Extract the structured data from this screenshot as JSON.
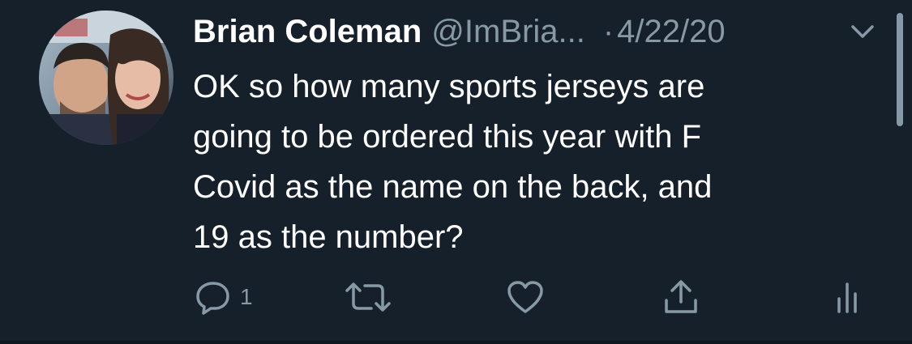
{
  "tweet": {
    "author": {
      "display_name": "Brian Coleman",
      "handle": "@ImBria...",
      "avatar": "profile-photo"
    },
    "separator": "·",
    "date": "4/22/20",
    "text": "OK so how many sports jerseys are\ngoing to be ordered this year with F\nCovid as the name on the back, and\n19 as the number?",
    "actions": {
      "reply_count": "1"
    }
  },
  "icons": {
    "menu": "chevron-down-icon",
    "reply": "reply-icon",
    "retweet": "retweet-icon",
    "like": "heart-icon",
    "share": "share-icon",
    "analytics": "analytics-icon"
  },
  "colors": {
    "background": "#15202b",
    "primary_text": "#ffffff",
    "secondary_text": "#8899a6"
  }
}
